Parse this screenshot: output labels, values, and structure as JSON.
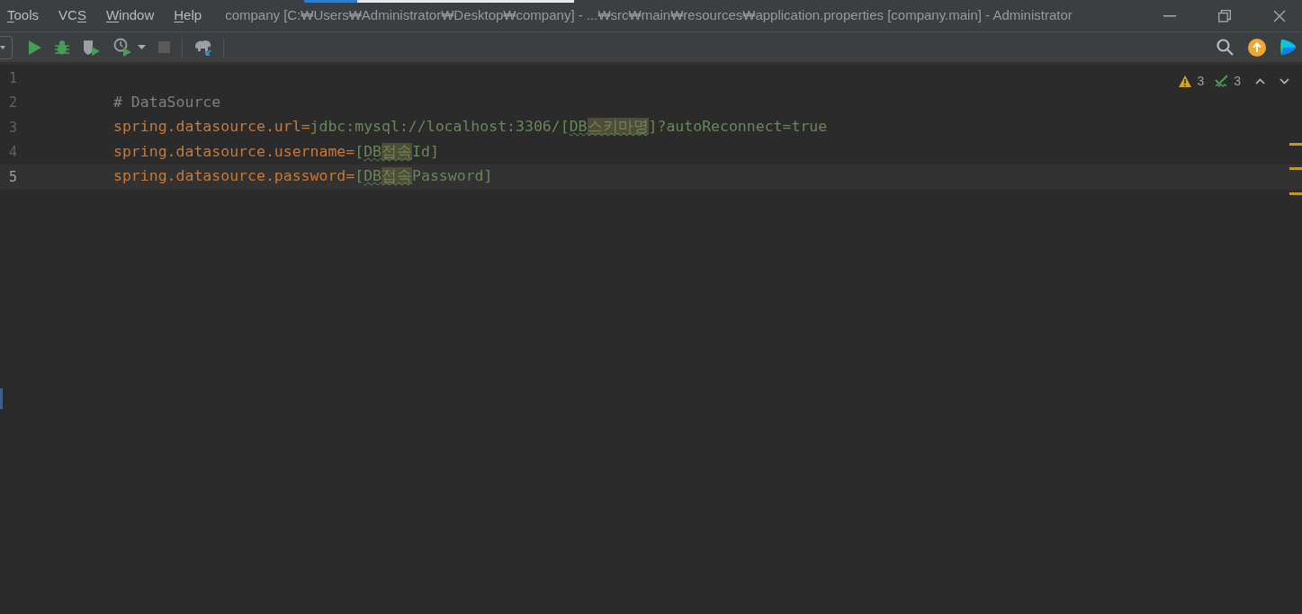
{
  "menu": [
    {
      "key": "T",
      "post": "ools"
    },
    {
      "pre": "VC",
      "key": "S"
    },
    {
      "key": "W",
      "post": "indow"
    },
    {
      "key": "H",
      "post": "elp"
    }
  ],
  "window": {
    "title": "company [C:₩Users₩Administrator₩Desktop₩company] - ...₩src₩main₩resources₩application.properties [company.main] - Administrator"
  },
  "toolbar": {
    "stop_disabled": true
  },
  "inspections": {
    "warnings": "3",
    "typos": "3"
  },
  "lines": [
    {
      "number": "1",
      "current": false
    },
    {
      "number": "2",
      "current": false,
      "tokens": [
        {
          "kind": "comment",
          "text": "# DataSource",
          "typo": false,
          "highlighted": false
        }
      ]
    },
    {
      "number": "3",
      "current": false,
      "tokens": [
        {
          "kind": "key",
          "text": "spring.datasource.url",
          "typo": false,
          "highlighted": false
        },
        {
          "kind": "op",
          "text": "=",
          "typo": false,
          "highlighted": false
        },
        {
          "kind": "value",
          "text": "jdbc:mysql://localhost:3306/[",
          "typo": false,
          "highlighted": false
        },
        {
          "kind": "value",
          "text": "DB",
          "typo": true,
          "highlighted": false
        },
        {
          "kind": "value",
          "text": "스키마명",
          "typo": true,
          "highlighted": true
        },
        {
          "kind": "value",
          "text": "]?autoReconnect=true",
          "typo": false,
          "highlighted": false
        }
      ]
    },
    {
      "number": "4",
      "current": false,
      "tokens": [
        {
          "kind": "key",
          "text": "spring.datasource.username",
          "typo": false,
          "highlighted": false
        },
        {
          "kind": "op",
          "text": "=",
          "typo": false,
          "highlighted": false
        },
        {
          "kind": "value",
          "text": "[",
          "typo": false,
          "highlighted": false
        },
        {
          "kind": "value",
          "text": "DB",
          "typo": true,
          "highlighted": false
        },
        {
          "kind": "value",
          "text": "접속",
          "typo": true,
          "highlighted": true
        },
        {
          "kind": "value",
          "text": "Id]",
          "typo": false,
          "highlighted": false
        }
      ]
    },
    {
      "number": "5",
      "current": true,
      "tokens": [
        {
          "kind": "key",
          "text": "spring.datasource.password",
          "typo": false,
          "highlighted": false
        },
        {
          "kind": "op",
          "text": "=",
          "typo": false,
          "highlighted": false
        },
        {
          "kind": "value",
          "text": "[",
          "typo": false,
          "highlighted": false
        },
        {
          "kind": "value",
          "text": "DB",
          "typo": true,
          "highlighted": false
        },
        {
          "kind": "value",
          "text": "접속",
          "typo": true,
          "highlighted": true
        },
        {
          "kind": "value",
          "text": "Password]",
          "typo": false,
          "highlighted": false
        }
      ]
    }
  ]
}
